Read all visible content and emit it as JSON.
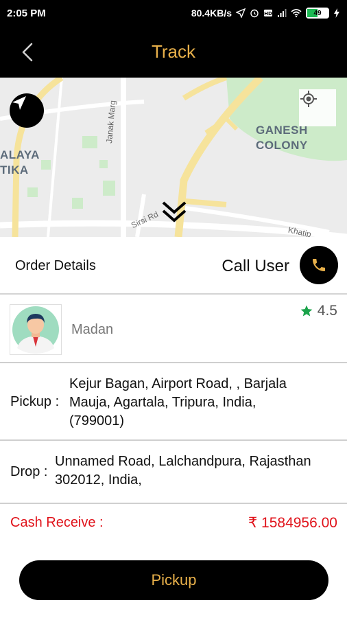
{
  "status_bar": {
    "time": "2:05 PM",
    "network_speed": "80.4KB/s",
    "battery_level": "49",
    "battery_fraction": 0.49,
    "icons": [
      "location-arrow-icon",
      "alarm-icon",
      "hd-icon",
      "signal-icon",
      "wifi-icon",
      "battery-icon",
      "charging-icon"
    ]
  },
  "header": {
    "title": "Track",
    "back_icon": "back-chevron-icon",
    "title_color": "#e8b04a"
  },
  "map": {
    "labels": {
      "area_left_line1": "ALAYA",
      "area_left_line2": "TIKA",
      "area_right_line1": "GANESH",
      "area_right_line2": "COLONY",
      "road_janak": "Janak Marg",
      "road_sirsi": "Sirsi Rd",
      "road_khatip": "Khatip"
    },
    "icons": [
      "navigation-arrow-icon",
      "my-location-icon",
      "double-chevron-down-icon"
    ]
  },
  "order_details": {
    "title": "Order Details",
    "call_label": "Call User",
    "call_icon": "phone-icon"
  },
  "user": {
    "name": "Madan",
    "rating": "4.5",
    "rating_icon": "star-icon",
    "star_color": "#1aa34a"
  },
  "pickup": {
    "label": "Pickup :",
    "address_line1": "Kejur Bagan, Airport Road, , Barjala",
    "address_line2": "Mauja, Agartala, Tripura, India,",
    "address_line3": "(799001)"
  },
  "drop": {
    "label": "Drop :",
    "address_line1": "Unnamed Road, Lalchandpura, Rajasthan",
    "address_line2": "302012, India,"
  },
  "cash": {
    "label": "Cash Receive :",
    "value": "₹ 1584956.00",
    "color": "#e0121a"
  },
  "action": {
    "pickup_button": "Pickup"
  }
}
